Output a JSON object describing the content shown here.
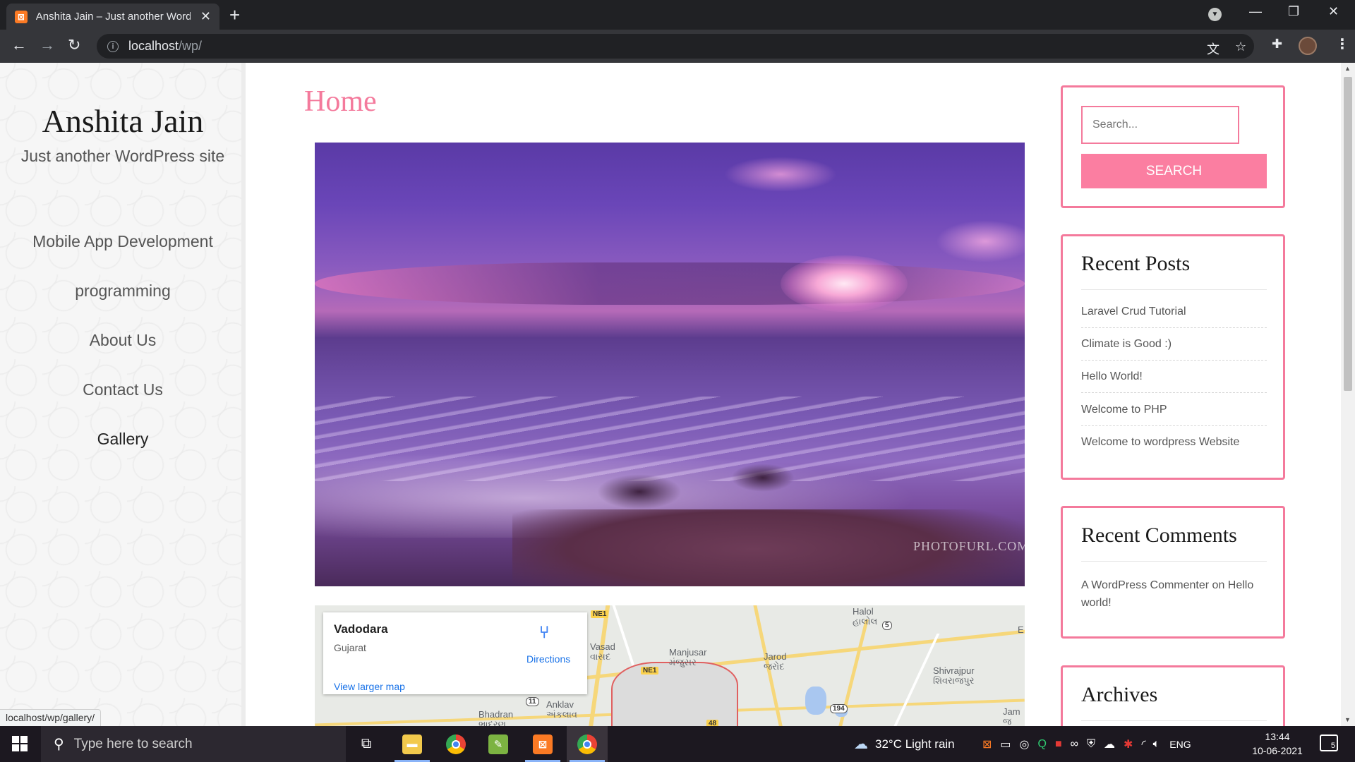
{
  "browser": {
    "tab_title": "Anshita Jain – Just another WordPress site",
    "tab_favicon": "xampp-icon",
    "url_host": "localhost",
    "url_path": "/wp/",
    "status_url": "localhost/wp/gallery/"
  },
  "site": {
    "title": "Anshita Jain",
    "tagline": "Just another WordPress site",
    "menu": [
      "Mobile App Development",
      "programming",
      "About Us",
      "Contact Us",
      "Gallery"
    ]
  },
  "main": {
    "page_title": "Home",
    "image_watermark": "PHOTOFURL.COM",
    "map": {
      "place": "Vadodara",
      "region": "Gujarat",
      "directions_label": "Directions",
      "larger_map_label": "View larger map",
      "labels": {
        "halol": "Halol",
        "halol_gu": "હાલોલ",
        "vasad": "Vasad",
        "vasad_gu": "વાસદ",
        "manjusar": "Manjusar",
        "manjusar_gu": "મંજુસર",
        "jarod": "Jarod",
        "jarod_gu": "જરોદ",
        "shivrajpur": "Shivrajpur",
        "shivrajpur_gu": "શિવરાજપુર",
        "anklav": "Anklav",
        "anklav_gu": "અંકલાવ",
        "bhadran": "Bhadran",
        "bhadran_gu": "ભાદરણ",
        "jam": "Jam",
        "jam_gu": "જ",
        "e_edge": "E",
        "ne1_a": "NE1",
        "ne1_b": "NE1",
        "r5": "5",
        "r11": "11",
        "r194": "194",
        "r48": "48"
      }
    }
  },
  "sidebar": {
    "search_placeholder": "Search...",
    "search_button": "SEARCH",
    "recent_posts_title": "Recent Posts",
    "recent_posts": [
      "Laravel Crud Tutorial",
      "Climate is Good :)",
      "Hello World!",
      "Welcome to PHP",
      "Welcome to wordpress Website"
    ],
    "recent_comments_title": "Recent Comments",
    "comment_author": "A WordPress Commenter",
    "comment_on": "on",
    "comment_post": "Hello world!",
    "archives_title": "Archives"
  },
  "taskbar": {
    "search_placeholder": "Type here to search",
    "weather": "32°C  Light rain",
    "language": "ENG",
    "time": "13:44",
    "date": "10-06-2021",
    "notifications": "5"
  },
  "colors": {
    "accent_pink": "#f47a9c",
    "button_pink": "#fb7ea1",
    "chrome_dark": "#202124",
    "link_blue": "#1a73e8"
  }
}
